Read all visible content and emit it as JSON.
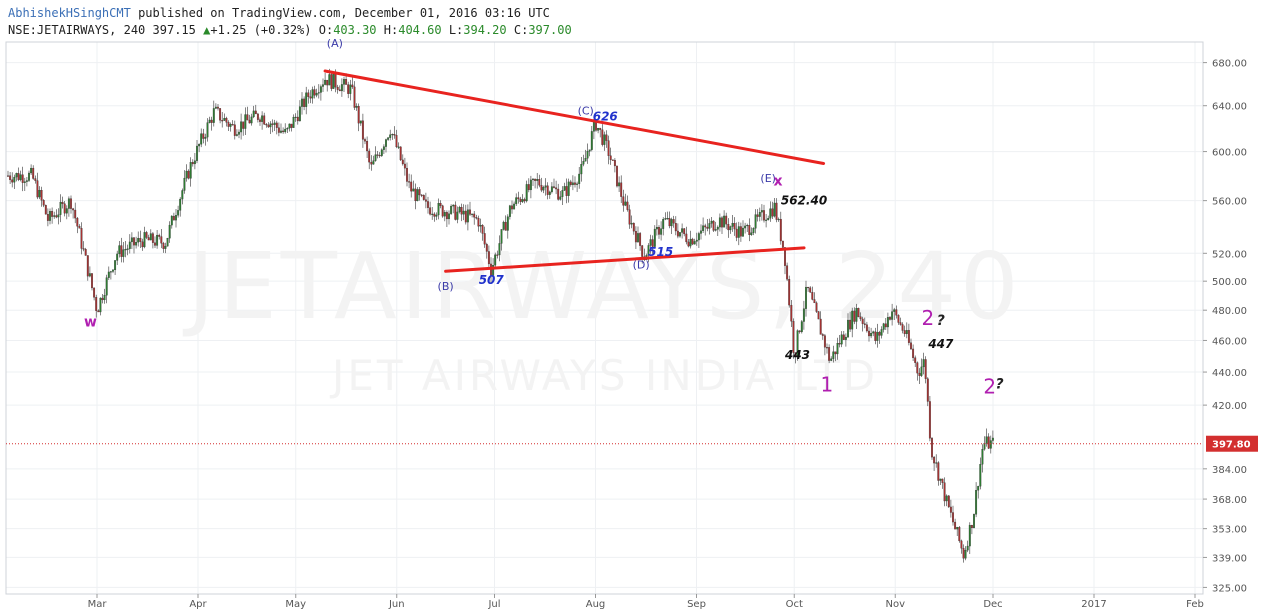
{
  "header": {
    "author": "AbhishekHSinghCMT",
    "published": "published on TradingView.com, December 01, 2016 03:16 UTC",
    "symbol": "NSE:JETAIRWAYS, 240",
    "last": "397.15",
    "change_arrow": "▲",
    "change": "+1.25 (+0.32%)",
    "o_label": "O:",
    "o": "403.30",
    "h_label": "H:",
    "h": "404.60",
    "l_label": "L:",
    "l": "394.20",
    "c_label": "C:",
    "c": "397.00"
  },
  "watermark": {
    "symbol": "JETAIRWAYS, 240",
    "name": "JET AIRWAYS INDIA LTD"
  },
  "colors": {
    "up": "#2e7d32",
    "down": "#a83232",
    "trendline": "#e8231f",
    "price_line": "#d32f2f",
    "wave_label": "#b01fb0",
    "abcde_label": "#3a3aa8"
  },
  "chart_data": {
    "type": "candlestick",
    "scale": "log",
    "ylim": [
      322,
      700
    ],
    "yticks": [
      325.0,
      339.0,
      353.0,
      368.0,
      384.0,
      420.0,
      440.0,
      460.0,
      480.0,
      500.0,
      520.0,
      560.0,
      600.0,
      640.0,
      680.0
    ],
    "xticks": [
      "Mar",
      "Apr",
      "May",
      "Jun",
      "Jul",
      "Aug",
      "Sep",
      "Oct",
      "Nov",
      "Dec",
      "2017",
      "Feb"
    ],
    "last_price": "397.80",
    "path": [
      [
        "2016-02-10",
        580
      ],
      [
        "2016-02-15",
        545
      ],
      [
        "2016-02-22",
        560
      ],
      [
        "2016-03-01",
        480
      ],
      [
        "2016-03-07",
        520
      ],
      [
        "2016-03-15",
        530
      ],
      [
        "2016-03-22",
        528
      ],
      [
        "2016-03-30",
        590
      ],
      [
        "2016-04-06",
        635
      ],
      [
        "2016-04-12",
        620
      ],
      [
        "2016-04-20",
        632
      ],
      [
        "2016-04-28",
        615
      ],
      [
        "2016-05-05",
        650
      ],
      [
        "2016-05-10",
        665
      ],
      [
        "2016-05-18",
        655
      ],
      [
        "2016-05-24",
        585
      ],
      [
        "2016-05-30",
        620
      ],
      [
        "2016-06-05",
        570
      ],
      [
        "2016-06-10",
        555
      ],
      [
        "2016-06-20",
        550
      ],
      [
        "2016-06-26",
        545
      ],
      [
        "2016-06-30",
        508
      ],
      [
        "2016-07-06",
        555
      ],
      [
        "2016-07-14",
        575
      ],
      [
        "2016-07-22",
        565
      ],
      [
        "2016-07-28",
        585
      ],
      [
        "2016-08-01",
        625
      ],
      [
        "2016-08-05",
        600
      ],
      [
        "2016-08-10",
        555
      ],
      [
        "2016-08-16",
        518
      ],
      [
        "2016-08-22",
        545
      ],
      [
        "2016-08-30",
        530
      ],
      [
        "2016-09-08",
        545
      ],
      [
        "2016-09-15",
        535
      ],
      [
        "2016-09-25",
        555
      ],
      [
        "2016-09-28",
        520
      ],
      [
        "2016-10-01",
        450
      ],
      [
        "2016-10-05",
        495
      ],
      [
        "2016-10-12",
        447
      ],
      [
        "2016-10-20",
        480
      ],
      [
        "2016-10-26",
        460
      ],
      [
        "2016-10-31",
        480
      ],
      [
        "2016-11-04",
        465
      ],
      [
        "2016-11-08",
        440
      ],
      [
        "2016-11-10",
        447
      ],
      [
        "2016-11-12",
        395
      ],
      [
        "2016-11-17",
        365
      ],
      [
        "2016-11-22",
        340
      ],
      [
        "2016-11-25",
        360
      ],
      [
        "2016-11-28",
        398
      ],
      [
        "2016-12-01",
        397.8
      ]
    ],
    "trendlines": [
      {
        "from": [
          "2016-05-10",
          672
        ],
        "to": [
          "2016-10-10",
          590
        ]
      },
      {
        "from": [
          "2016-06-16",
          507
        ],
        "to": [
          "2016-10-04",
          524
        ]
      }
    ],
    "annotations": [
      {
        "text": "(A)",
        "kind": "wave",
        "at": [
          "2016-05-13",
          695
        ]
      },
      {
        "text": "(B)",
        "kind": "wave",
        "at": [
          "2016-06-16",
          494
        ]
      },
      {
        "text": "507",
        "kind": "price",
        "at": [
          "2016-06-30",
          498
        ]
      },
      {
        "text": "(C)",
        "kind": "wave",
        "at": [
          "2016-07-29",
          632
        ]
      },
      {
        "text": "626",
        "kind": "price",
        "at": [
          "2016-08-04",
          627
        ]
      },
      {
        "text": "(D)",
        "kind": "wave",
        "at": [
          "2016-08-15",
          509
        ]
      },
      {
        "text": "515",
        "kind": "price",
        "at": [
          "2016-08-21",
          518
        ]
      },
      {
        "text": "(E)",
        "kind": "wave",
        "at": [
          "2016-09-23",
          575
        ]
      },
      {
        "text": "x",
        "kind": "major",
        "at": [
          "2016-09-26",
          572
        ]
      },
      {
        "text": "562.40",
        "kind": "price_dark",
        "at": [
          "2016-10-04",
          557
        ]
      },
      {
        "text": "w",
        "kind": "major",
        "at": [
          "2016-02-28",
          469
        ]
      },
      {
        "text": "443",
        "kind": "price_dark",
        "at": [
          "2016-10-02",
          448
        ]
      },
      {
        "text": "1",
        "kind": "major_big",
        "at": [
          "2016-10-11",
          428
        ]
      },
      {
        "text": "2",
        "kind": "major_big",
        "at": [
          "2016-11-11",
          470
        ]
      },
      {
        "text": "?",
        "kind": "question",
        "at": [
          "2016-11-15",
          470
        ]
      },
      {
        "text": "447",
        "kind": "price_dark",
        "at": [
          "2016-11-15",
          455
        ]
      },
      {
        "text": "2",
        "kind": "major_big",
        "at": [
          "2016-11-30",
          427
        ]
      },
      {
        "text": "?",
        "kind": "question",
        "at": [
          "2016-12-03",
          430
        ]
      }
    ]
  }
}
